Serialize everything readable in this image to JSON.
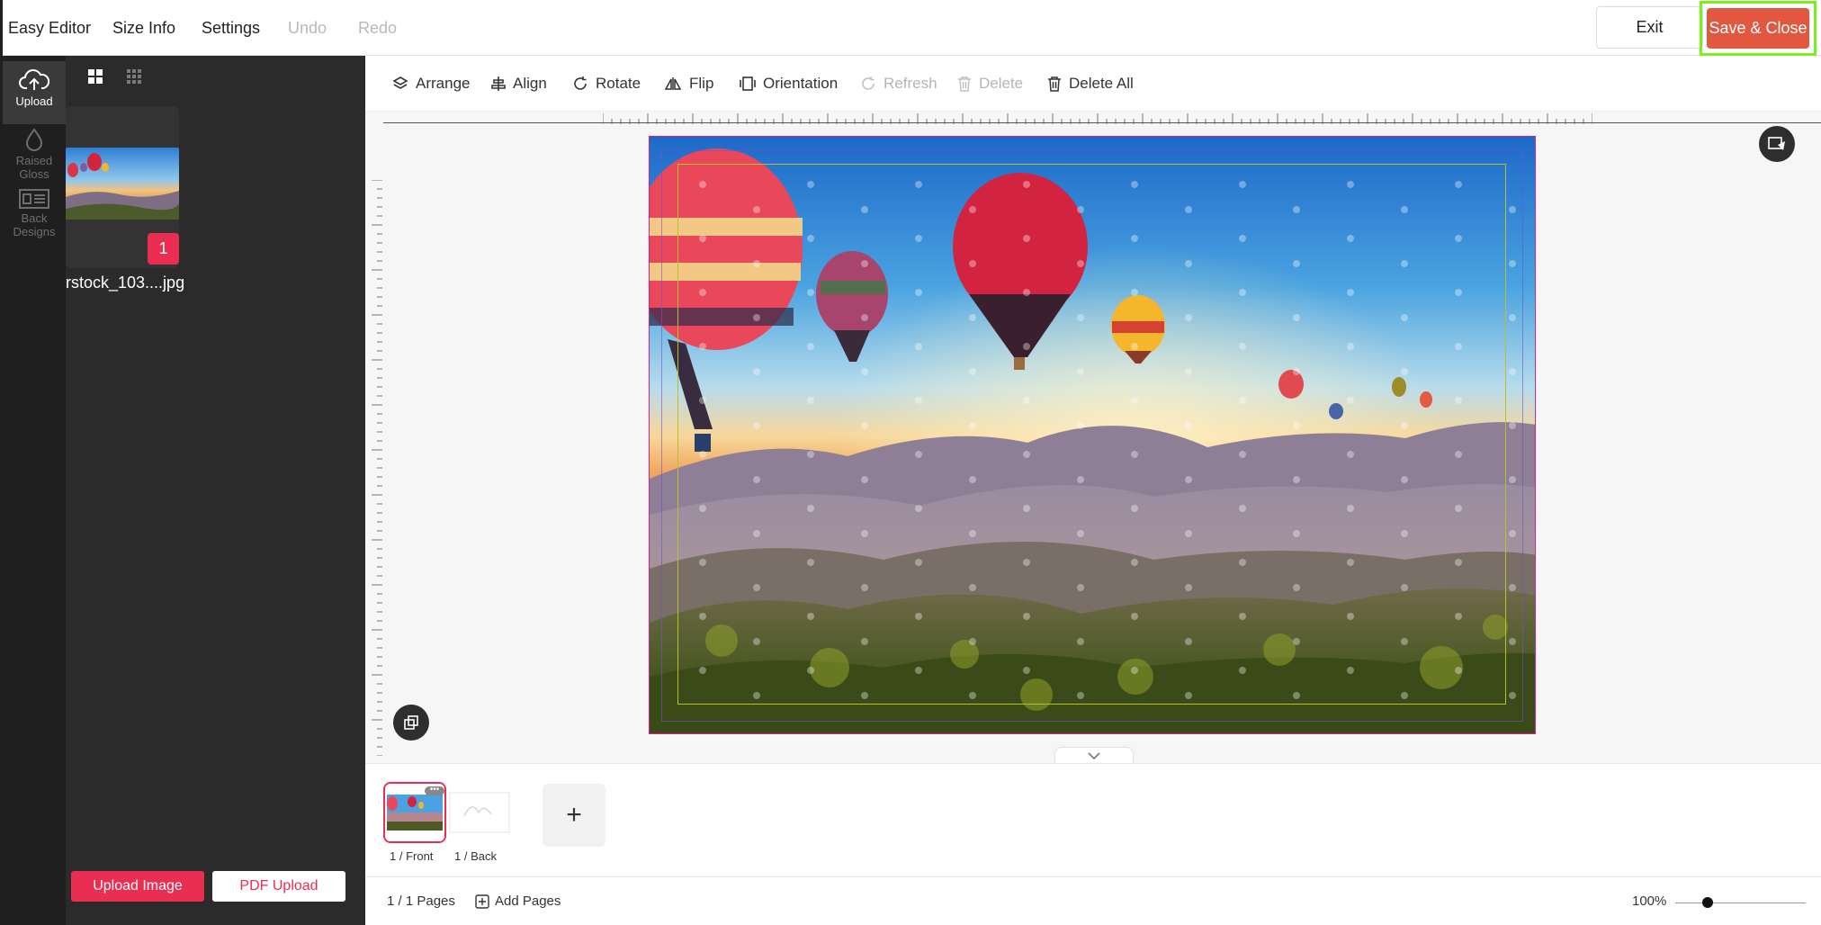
{
  "topbar": {
    "menu": [
      "Easy Editor",
      "Size Info",
      "Settings",
      "Undo",
      "Redo"
    ],
    "exit_label": "Exit",
    "save_label": "Save & Close"
  },
  "rail": {
    "items": [
      {
        "label": "Upload",
        "icon": "cloud-upload-icon"
      },
      {
        "label": "Raised\nGloss",
        "icon": "drop-icon"
      },
      {
        "label": "Back\nDesigns",
        "icon": "back-design-icon"
      }
    ]
  },
  "panel": {
    "view_modes": [
      "grid-large-icon",
      "grid-small-icon"
    ],
    "image_name": "rstock_103....jpg",
    "image_count": "1",
    "upload_button": "Upload Image",
    "pdf_button": "PDF Upload"
  },
  "toolbar": {
    "tools": [
      {
        "label": "Arrange",
        "icon": "layers-icon",
        "enabled": true
      },
      {
        "label": "Align",
        "icon": "align-icon",
        "enabled": true
      },
      {
        "label": "Rotate",
        "icon": "rotate-icon",
        "enabled": true
      },
      {
        "label": "Flip",
        "icon": "flip-icon",
        "enabled": true
      },
      {
        "label": "Orientation",
        "icon": "orientation-icon",
        "enabled": true
      },
      {
        "label": "Refresh",
        "icon": "refresh-icon",
        "enabled": false
      },
      {
        "label": "Delete",
        "icon": "trash-icon",
        "enabled": false
      },
      {
        "label": "Delete All",
        "icon": "trash-icon",
        "enabled": true
      }
    ]
  },
  "canvas": {
    "image": "hot-air-balloons-over-mountains",
    "colors": {
      "trim": "#d81f8a",
      "safe": "#b9c12a"
    }
  },
  "pages": {
    "items": [
      {
        "label": "1 / Front",
        "active": true
      },
      {
        "label": "1 / Back",
        "active": false
      }
    ],
    "add_tile": "+"
  },
  "status": {
    "page_count": "1 / 1 Pages",
    "add_pages": "Add Pages",
    "zoom": "100%",
    "zoom_fraction": 0.25
  },
  "colors": {
    "accent": "#ea2e51",
    "save": "#e2573f",
    "highlight": "#7cf01c",
    "panel": "#2b2b2b",
    "rail": "#1f1f1f"
  }
}
